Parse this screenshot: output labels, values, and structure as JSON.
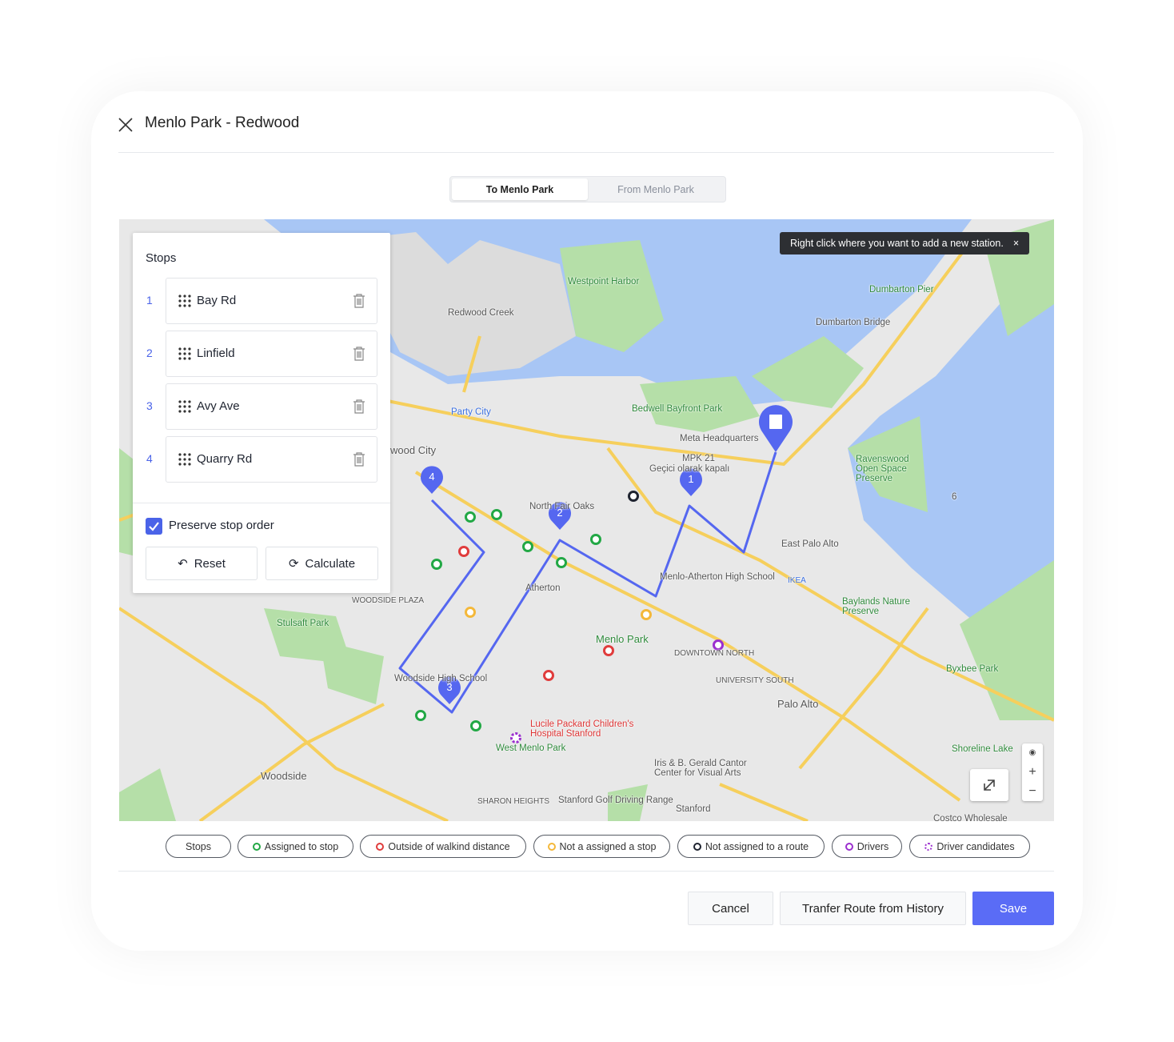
{
  "header": {
    "title": "Menlo Park - Redwood"
  },
  "tabs": [
    {
      "label": "To Menlo Park",
      "active": true
    },
    {
      "label": "From Menlo Park",
      "active": false
    }
  ],
  "tooltip": {
    "text": "Right click where you want to add a new station.",
    "close": "×"
  },
  "stops_panel": {
    "title": "Stops",
    "stops": [
      {
        "n": "1",
        "name": "Bay Rd"
      },
      {
        "n": "2",
        "name": "Linfield"
      },
      {
        "n": "3",
        "name": "Avy Ave"
      },
      {
        "n": "4",
        "name": "Quarry Rd"
      }
    ],
    "preserve_label": "Preserve stop order",
    "preserve_checked": true,
    "reset_label": "Reset",
    "calculate_label": "Calculate"
  },
  "map": {
    "labels": [
      "Westpoint Harbor",
      "Dumbarton Pier",
      "Dumbarton Bridge",
      "Party City",
      "Bedwell Bayfront Park",
      "Meta Headquarters",
      "MPK 21",
      "Geçici olarak kapalı",
      "Ravenswood Open Space Preserve",
      "East Palo Alto",
      "IKEA",
      "Baylands Nature Preserve",
      "wood City",
      "North Fair Oaks",
      "Atherton",
      "Menlo-Atherton High School",
      "WOODSIDE PLAZA",
      "Stulsaft Park",
      "Menlo Park",
      "DOWNTOWN NORTH",
      "UNIVERSITY SOUTH",
      "Palo Alto",
      "Byxbee Park",
      "Woodside High School",
      "Lucile Packard Children's Hospital Stanford",
      "West Menlo Park",
      "Iris & B. Gerald Cantor Center for Visual Arts",
      "Woodside",
      "SHARON HEIGHTS",
      "Stanford Golf Driving Range",
      "Stanford",
      "Shoreline Lake",
      "Costco Wholesale",
      "Redwood Creek",
      "6"
    ],
    "route_markers": [
      "1",
      "2",
      "3",
      "4"
    ],
    "zoom_in": "+",
    "zoom_out": "−",
    "colors": {
      "water": "#a8c6f5",
      "land": "#e8e8e8",
      "park": "#b5dfa8",
      "road": "#f6cf5c",
      "route": "#5567f0"
    }
  },
  "legend": [
    {
      "label": "Stops",
      "color": null
    },
    {
      "label": "Assigned to stop",
      "color": "#22a845"
    },
    {
      "label": "Outside of walkind distance",
      "color": "#e03c3c"
    },
    {
      "label": "Not a assigned a stop",
      "color": "#f4b83a"
    },
    {
      "label": "Not assigned to a route",
      "color": "#1f2430"
    },
    {
      "label": "Drivers",
      "color": "#9b2fcf"
    },
    {
      "label": "Driver candidates",
      "color": "#9b2fcf",
      "dashed": true
    }
  ],
  "footer": {
    "cancel": "Cancel",
    "transfer": "Tranfer Route from History",
    "save": "Save",
    "save_color": "#5a6cf6"
  }
}
